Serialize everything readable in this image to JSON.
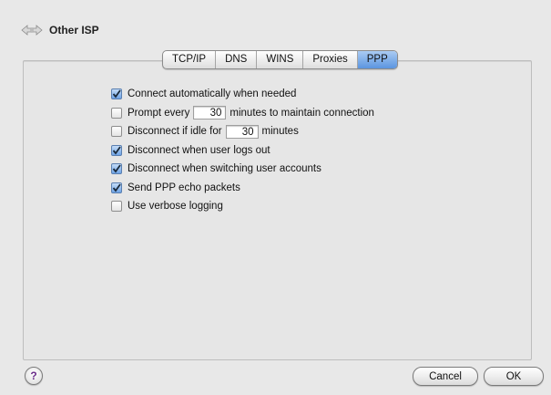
{
  "header": {
    "title": "Other ISP",
    "icon": "network-arrows-icon"
  },
  "tabs": [
    {
      "label": "TCP/IP",
      "active": false
    },
    {
      "label": "DNS",
      "active": false
    },
    {
      "label": "WINS",
      "active": false
    },
    {
      "label": "Proxies",
      "active": false
    },
    {
      "label": "PPP",
      "active": true
    }
  ],
  "options": {
    "connect_auto": {
      "label": "Connect automatically when needed",
      "checked": true
    },
    "prompt": {
      "label_before": "Prompt every",
      "value": "30",
      "label_after": "minutes to maintain connection",
      "checked": false
    },
    "idle": {
      "label_before": "Disconnect if idle for",
      "value": "30",
      "label_after": "minutes",
      "checked": false
    },
    "logout": {
      "label": "Disconnect when user logs out",
      "checked": true
    },
    "switching": {
      "label": "Disconnect when switching user accounts",
      "checked": true
    },
    "echo": {
      "label": "Send PPP echo packets",
      "checked": true
    },
    "verbose": {
      "label": "Use verbose logging",
      "checked": false
    }
  },
  "footer": {
    "help": "?",
    "cancel_label": "Cancel",
    "ok_label": "OK"
  },
  "colors": {
    "accent": "#5b95e0",
    "background": "#e8e8e8"
  }
}
